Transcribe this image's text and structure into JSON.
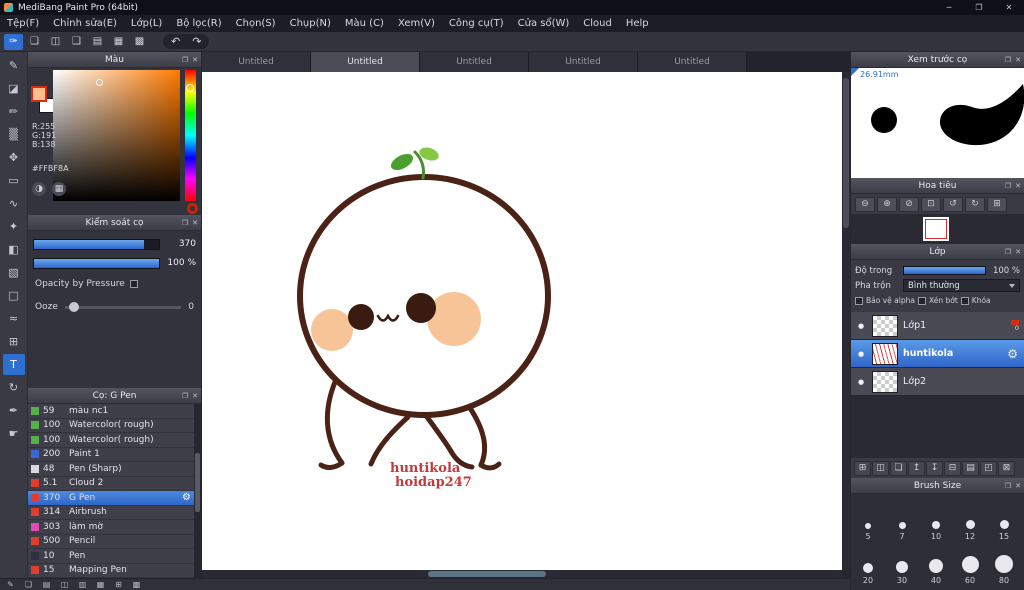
{
  "window": {
    "title": "MediBang Paint Pro (64bit)",
    "minimize_glyph": "─",
    "maximize_glyph": "❐",
    "close_glyph": "✕"
  },
  "menubar": {
    "items": [
      "Tệp(F)",
      "Chỉnh sửa(E)",
      "Lớp(L)",
      "Bộ lọc(R)",
      "Chọn(S)",
      "Chụp(N)",
      "Màu (C)",
      "Xem(V)",
      "Công cụ(T)",
      "Cửa sổ(W)",
      "Cloud",
      "Help"
    ]
  },
  "toolbar": {
    "buttons": [
      {
        "name": "paint-mode-button",
        "glyph": "✑",
        "selected": true
      },
      {
        "name": "new-canvas-button",
        "glyph": "❏"
      },
      {
        "name": "save-button",
        "glyph": "◫"
      },
      {
        "name": "comment-button",
        "glyph": "❑"
      },
      {
        "name": "snapshot-button",
        "glyph": "▤"
      },
      {
        "name": "material-button",
        "glyph": "▦"
      },
      {
        "name": "grid-button",
        "glyph": "▩"
      }
    ],
    "undo_glyph": "↶",
    "redo_glyph": "↷"
  },
  "tools": {
    "items": [
      {
        "name": "brush-tool",
        "glyph": "✎"
      },
      {
        "name": "eraser-tool",
        "glyph": "◪"
      },
      {
        "name": "pen-tool",
        "glyph": "✏"
      },
      {
        "name": "airbrush-tool",
        "glyph": "▒"
      },
      {
        "name": "move-tool",
        "glyph": "✥"
      },
      {
        "name": "select-rect-tool",
        "glyph": "▭"
      },
      {
        "name": "lasso-tool",
        "glyph": "∿"
      },
      {
        "name": "magic-wand-tool",
        "glyph": "✦"
      },
      {
        "name": "bucket-tool",
        "glyph": "◧"
      },
      {
        "name": "gradient-tool",
        "glyph": "▧"
      },
      {
        "name": "shape-tool",
        "glyph": "□"
      },
      {
        "name": "curve-tool",
        "glyph": "≈"
      },
      {
        "name": "grid-tool",
        "glyph": "⊞"
      },
      {
        "name": "text-tool",
        "glyph": "T",
        "selected": true
      },
      {
        "name": "rotate-tool",
        "glyph": "↻"
      },
      {
        "name": "eyedropper-tool",
        "glyph": "✒"
      },
      {
        "name": "hand-tool",
        "glyph": "☛"
      }
    ]
  },
  "ui": {
    "undock_glyph": "❐",
    "close_glyph": "✕",
    "eye_glyph": "●",
    "gear_glyph": "⚙"
  },
  "color_panel": {
    "title": "Màu",
    "r_label": "R:255",
    "g_label": "G:191",
    "b_label": "B:138",
    "hex_label": "#FFBF8A",
    "fg_color": "#ffbf8a",
    "wheel_glyph": "◑",
    "palette_glyph": "▦"
  },
  "brush_control": {
    "title": "Kiểm soát cọ",
    "size_value": "370",
    "opacity_value": "100 %",
    "pressure_label": "Opacity by Pressure",
    "ooze_label": "Ooze",
    "ooze_value": "0"
  },
  "brushes": {
    "title": "Cọ: G Pen",
    "items": [
      {
        "chip": "#55b04a",
        "num": "59",
        "name": "màu nc1"
      },
      {
        "chip": "#55b04a",
        "num": "100",
        "name": "Watercolor( rough)"
      },
      {
        "chip": "#55b04a",
        "num": "100",
        "name": "Watercolor( rough)"
      },
      {
        "chip": "#3a66d8",
        "num": "200",
        "name": "Paint 1"
      },
      {
        "chip": "#d8d8de",
        "num": "48",
        "name": "Pen (Sharp)"
      },
      {
        "chip": "#e23c2e",
        "num": "5.1",
        "name": "Cloud 2"
      },
      {
        "chip": "#e23c2e",
        "num": "370",
        "name": "G Pen",
        "selected": true
      },
      {
        "chip": "#e23c2e",
        "num": "314",
        "name": "Airbrush"
      },
      {
        "chip": "#e24ab4",
        "num": "303",
        "name": "làm mờ"
      },
      {
        "chip": "#e23c2e",
        "num": "500",
        "name": "Pencil"
      },
      {
        "chip": "#2e2e44",
        "num": "10",
        "name": "Pen"
      },
      {
        "chip": "#e23c2e",
        "num": "15",
        "name": "Mapping Pen"
      }
    ]
  },
  "tabs": {
    "items": [
      {
        "label": "Untitled"
      },
      {
        "label": "Untitled",
        "selected": true
      },
      {
        "label": "Untitled"
      },
      {
        "label": "Untitled"
      },
      {
        "label": "Untitled"
      }
    ]
  },
  "canvas": {
    "signature_line1": "huntikola",
    "signature_line2": "hoidap247"
  },
  "preview": {
    "title": "Xem trước cọ",
    "size_label": "26.91mm"
  },
  "navigator": {
    "title": "Hoa tiêu",
    "buttons": [
      {
        "name": "zoom-out-button",
        "glyph": "⊖"
      },
      {
        "name": "zoom-in-button",
        "glyph": "⊕"
      },
      {
        "name": "zoom-reset-button",
        "glyph": "⊘"
      },
      {
        "name": "fit-window-button",
        "glyph": "⊡"
      },
      {
        "name": "rotate-left-button",
        "glyph": "↺"
      },
      {
        "name": "rotate-right-button",
        "glyph": "↻"
      },
      {
        "name": "reset-view-button",
        "glyph": "⊞"
      }
    ]
  },
  "layers": {
    "title": "Lớp",
    "opacity_label": "Độ trong",
    "opacity_value": "100 %",
    "blend_label": "Pha trộn",
    "blend_value": "Bình thường",
    "check1": "Bảo vệ alpha",
    "check2": "Xén bớt",
    "check3": "Khóa",
    "items": [
      {
        "name": "Lớp1",
        "badge": "0"
      },
      {
        "name": "huntikola",
        "selected": true
      },
      {
        "name": "Lớp2"
      }
    ],
    "buttons": [
      {
        "name": "add-layer-button",
        "glyph": "⊞"
      },
      {
        "name": "add-folder-button",
        "glyph": "◫"
      },
      {
        "name": "duplicate-layer-button",
        "glyph": "❏"
      },
      {
        "name": "move-layer-up-button",
        "glyph": "↥"
      },
      {
        "name": "move-layer-down-button",
        "glyph": "↧"
      },
      {
        "name": "merge-layer-button",
        "glyph": "⊟"
      },
      {
        "name": "clear-layer-button",
        "glyph": "▤"
      },
      {
        "name": "mask-layer-button",
        "glyph": "◰"
      },
      {
        "name": "delete-layer-button",
        "glyph": "⊠"
      }
    ]
  },
  "brush_size": {
    "title": "Brush Size",
    "sizes": [
      "5",
      "7",
      "10",
      "12",
      "15",
      "20",
      "30",
      "40",
      "60",
      "80"
    ]
  },
  "bottom_bar": {
    "buttons": [
      {
        "name": "toggle-tools-panel-button",
        "glyph": "✎"
      },
      {
        "name": "toggle-brush-panel-button",
        "glyph": "❏"
      },
      {
        "name": "toggle-color-panel-button",
        "glyph": "▤"
      },
      {
        "name": "toggle-layer-panel-button",
        "glyph": "◫"
      },
      {
        "name": "toggle-navigator-panel-button",
        "glyph": "▥"
      },
      {
        "name": "toggle-material-panel-button",
        "glyph": "▦"
      },
      {
        "name": "add-panel-button",
        "glyph": "⊞"
      },
      {
        "name": "grid-toggle-button",
        "glyph": "▩"
      }
    ]
  }
}
